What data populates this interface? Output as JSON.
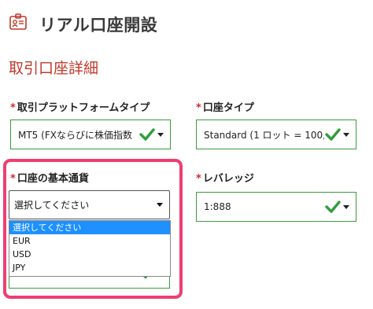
{
  "header": {
    "title": "リアル口座開設",
    "icon": "id-card-icon"
  },
  "section": {
    "title": "取引口座詳細"
  },
  "fields": {
    "platform": {
      "required_mark": "*",
      "label": "取引プラットフォームタイプ",
      "value": "MT5 (FXならびに株価指数",
      "valid": true
    },
    "account_type": {
      "required_mark": "*",
      "label": "口座タイプ",
      "value": "Standard (1 ロット = 100,",
      "valid": true
    },
    "base_currency": {
      "required_mark": "*",
      "label": "口座の基本通貨",
      "value": "選択してください",
      "options": [
        "選択してください",
        "EUR",
        "USD",
        "JPY"
      ],
      "highlighted_option": "選択してください",
      "open": true
    },
    "leverage": {
      "required_mark": "*",
      "label": "レバレッジ",
      "value": "1:888",
      "valid": true
    }
  },
  "colors": {
    "accent_red": "#c0392b",
    "required_red": "#d0282d",
    "valid_green": "#3a9b3a",
    "check_green": "#2e9e3b",
    "highlight_pink": "#ee3f72",
    "selected_blue": "#1e90ff"
  }
}
